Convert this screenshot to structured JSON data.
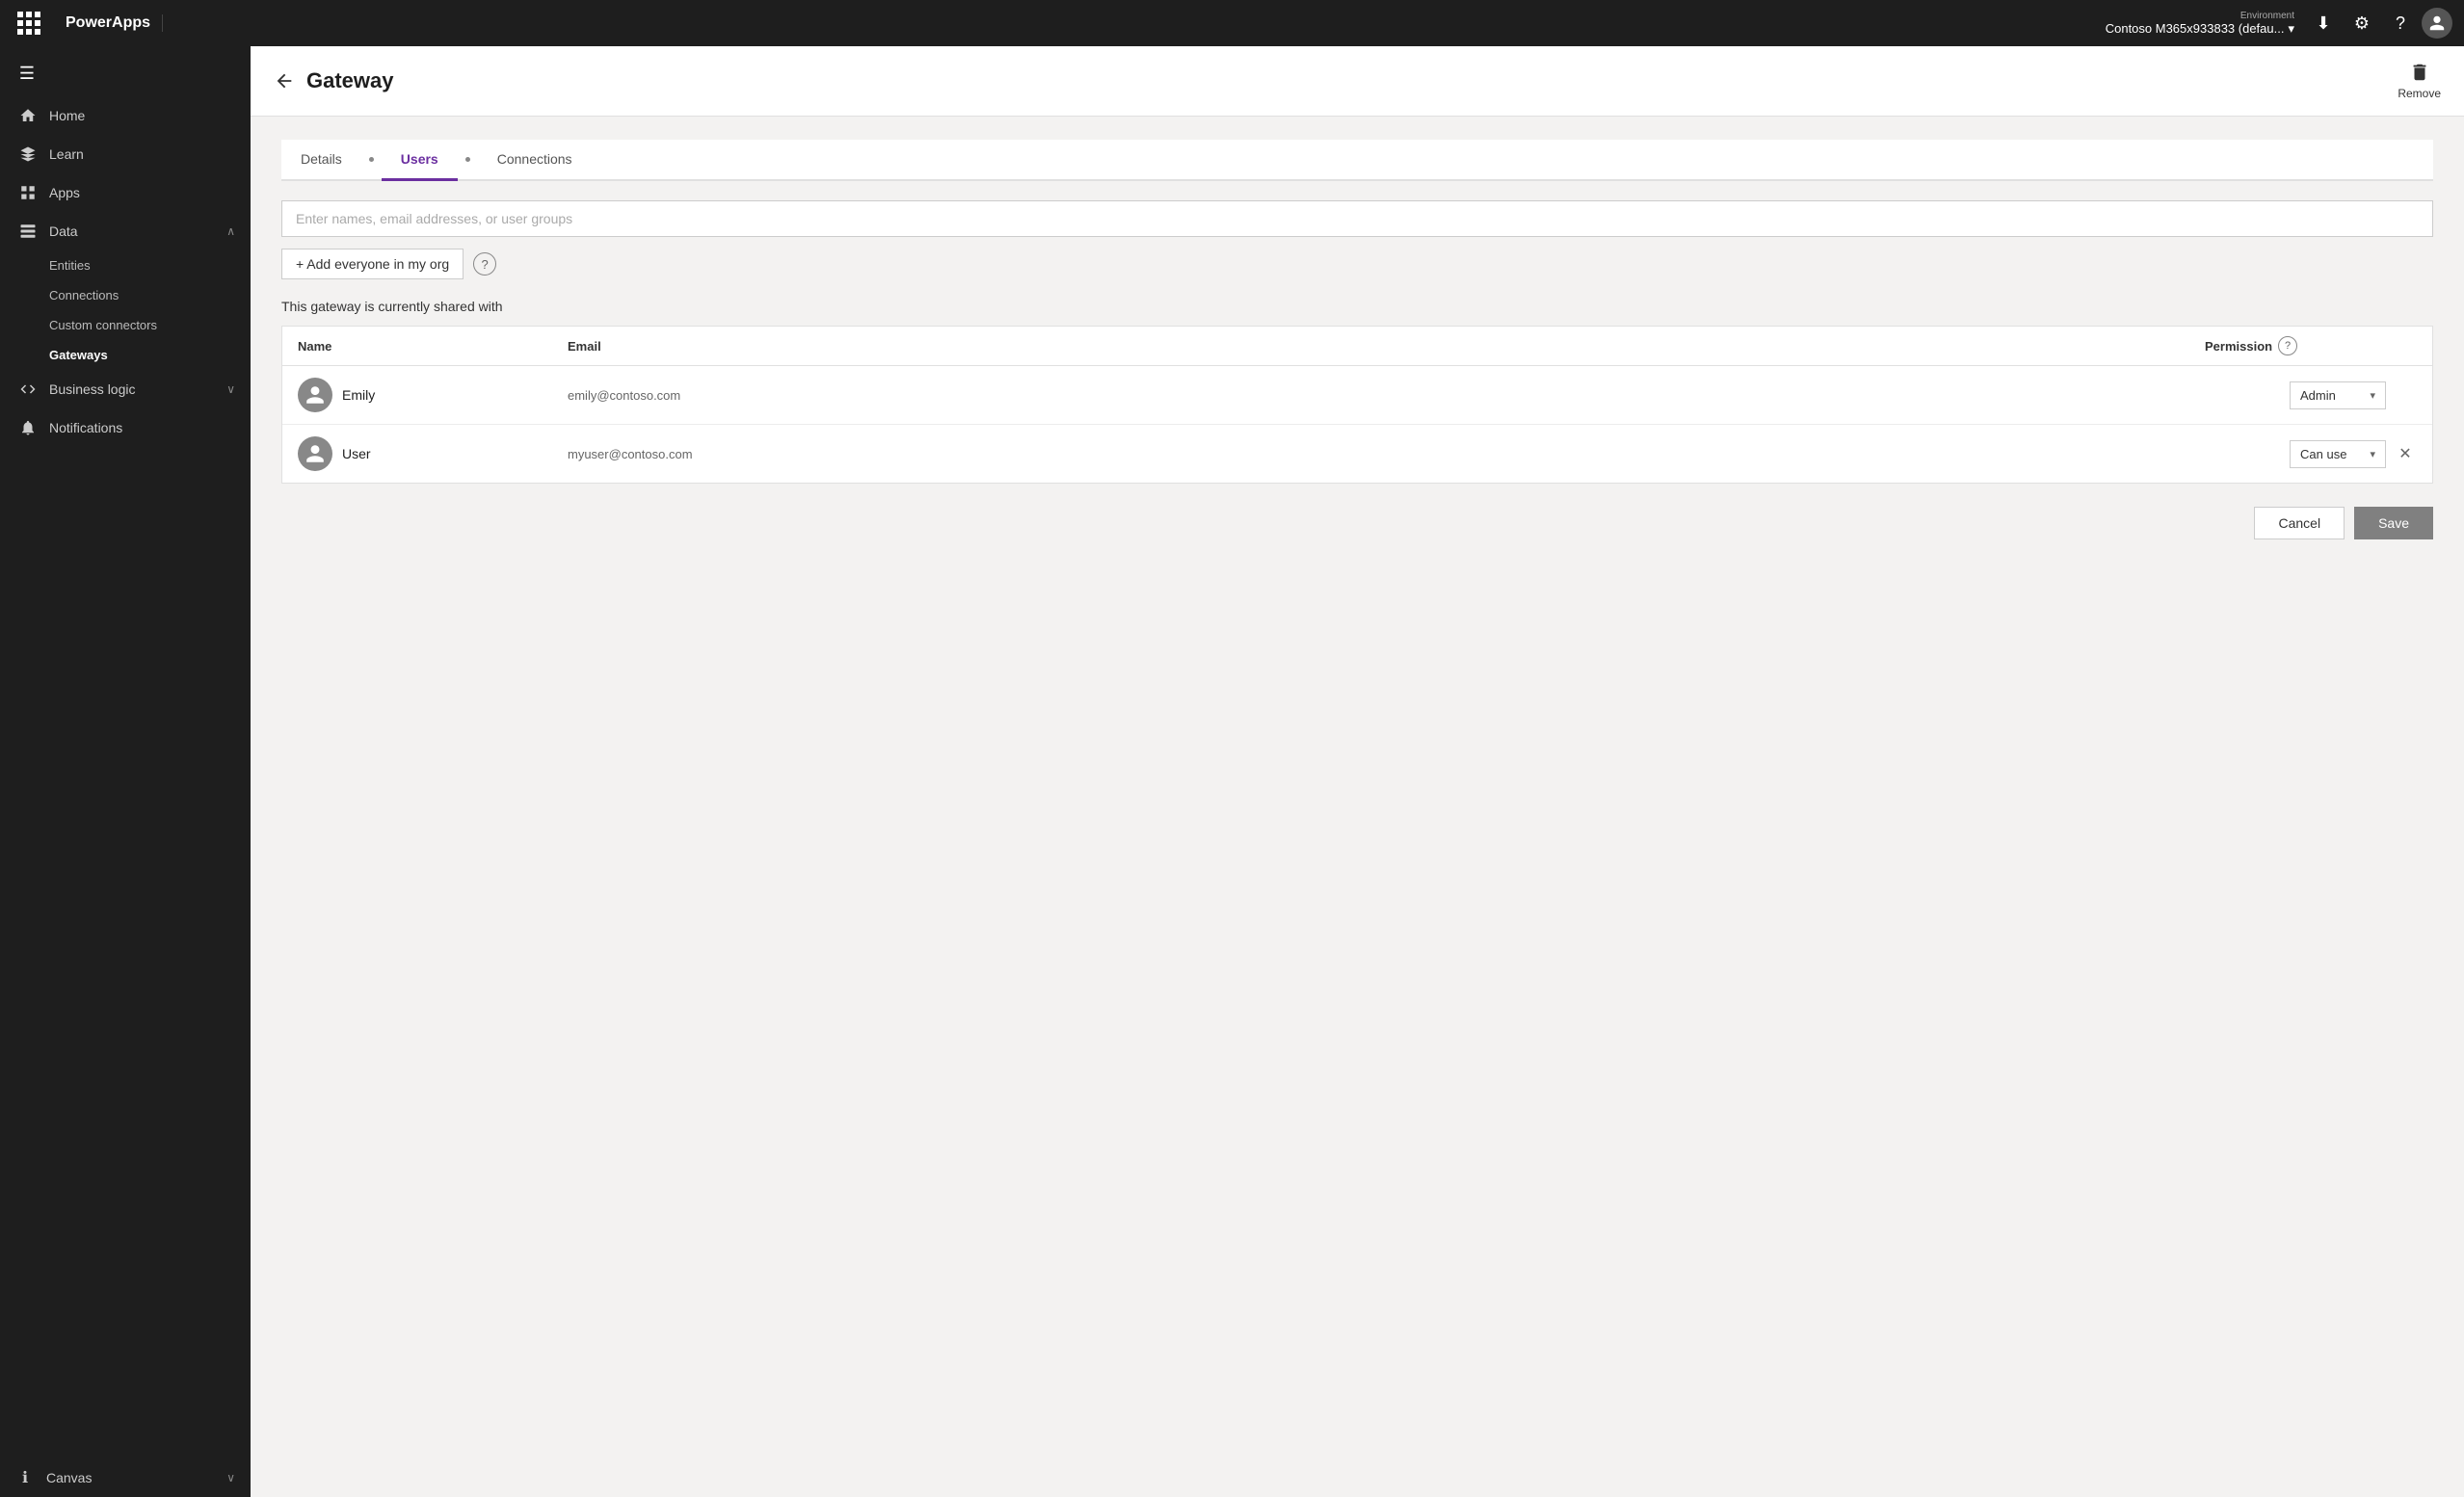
{
  "topbar": {
    "brand": "PowerApps",
    "env_label": "Environment",
    "env_value": "Contoso M365x933833 (defau...",
    "download_icon": "⬇",
    "settings_icon": "⚙",
    "help_icon": "?",
    "avatar_icon": "👤"
  },
  "sidebar": {
    "menu_icon": "☰",
    "items": [
      {
        "id": "home",
        "label": "Home",
        "icon": "🏠"
      },
      {
        "id": "learn",
        "label": "Learn",
        "icon": "📖"
      },
      {
        "id": "apps",
        "label": "Apps",
        "icon": "⬛"
      },
      {
        "id": "data",
        "label": "Data",
        "icon": "📊",
        "expanded": true,
        "chevron": "∧"
      },
      {
        "id": "entities",
        "label": "Entities",
        "sub": true
      },
      {
        "id": "connections",
        "label": "Connections",
        "sub": true
      },
      {
        "id": "custom-connectors",
        "label": "Custom connectors",
        "sub": true
      },
      {
        "id": "gateways",
        "label": "Gateways",
        "sub": true,
        "active": true
      },
      {
        "id": "business-logic",
        "label": "Business logic",
        "icon": "⚡",
        "chevron": "∨"
      },
      {
        "id": "notifications",
        "label": "Notifications",
        "icon": "🔔"
      }
    ],
    "bottom": {
      "item_label": "Canvas",
      "item_icon": "ℹ",
      "chevron": "∨"
    }
  },
  "page": {
    "title": "Gateway",
    "remove_label": "Remove"
  },
  "tabs": [
    {
      "id": "details",
      "label": "Details",
      "active": false
    },
    {
      "id": "users",
      "label": "Users",
      "active": true
    },
    {
      "id": "connections",
      "label": "Connections",
      "active": false
    }
  ],
  "users_tab": {
    "search_placeholder": "Enter names, email addresses, or user groups",
    "add_everyone_label": "+ Add everyone in my org",
    "help_tooltip": "?",
    "shared_with_text": "This gateway is currently shared with",
    "table": {
      "col_name": "Name",
      "col_email": "Email",
      "col_permission": "Permission",
      "help_icon": "?",
      "rows": [
        {
          "name": "Emily",
          "email": "emily@contoso.com",
          "permission": "Admin",
          "can_remove": false
        },
        {
          "name": "User",
          "email": "myuser@contoso.com",
          "permission": "Can use",
          "can_remove": true
        }
      ]
    },
    "cancel_label": "Cancel",
    "save_label": "Save"
  }
}
